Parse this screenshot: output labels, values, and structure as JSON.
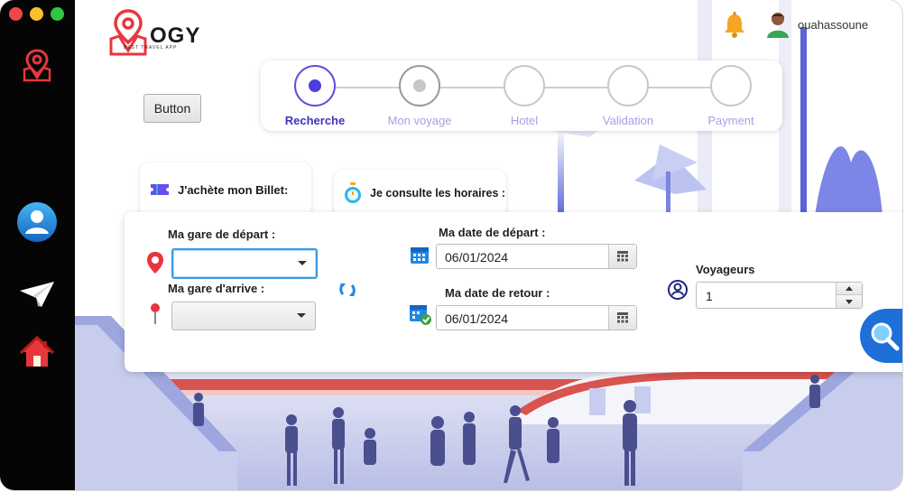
{
  "window": {
    "traffic_lights": [
      "close",
      "minimize",
      "maximize"
    ]
  },
  "sidebar": {
    "items": [
      {
        "icon": "map-pin-icon"
      },
      {
        "icon": "user-profile-icon"
      },
      {
        "icon": "paper-plane-icon"
      },
      {
        "icon": "home-icon"
      }
    ]
  },
  "brand": {
    "logo_text": "OGY",
    "tagline": "BEST TRAVEL APP"
  },
  "header": {
    "button_label": "Button",
    "username": "ouahassoune"
  },
  "stepper": {
    "steps": [
      {
        "label": "Recherche",
        "state": "active"
      },
      {
        "label": "Mon voyage",
        "state": "visited"
      },
      {
        "label": "Hotel",
        "state": "pending"
      },
      {
        "label": "Validation",
        "state": "pending"
      },
      {
        "label": "Payment",
        "state": "pending"
      }
    ]
  },
  "tabs": {
    "buy_ticket": "J'achète mon Billet:",
    "schedules": "Je consulte les horaires :"
  },
  "form": {
    "departure_station_label": "Ma gare de départ :",
    "departure_station_value": "",
    "arrival_station_label": "Ma gare d'arrive :",
    "arrival_station_value": "",
    "departure_date_label": "Ma date de départ :",
    "departure_date_value": "06/01/2024",
    "return_date_label": "Ma date de retour :",
    "return_date_value": "06/01/2024",
    "travelers_label": "Voyageurs",
    "travelers_value": "1"
  },
  "colors": {
    "accent": "#4b3fe0",
    "sidebar_bg": "#050505",
    "brand_red": "#e8363d",
    "search_blue": "#1e6fd8"
  }
}
